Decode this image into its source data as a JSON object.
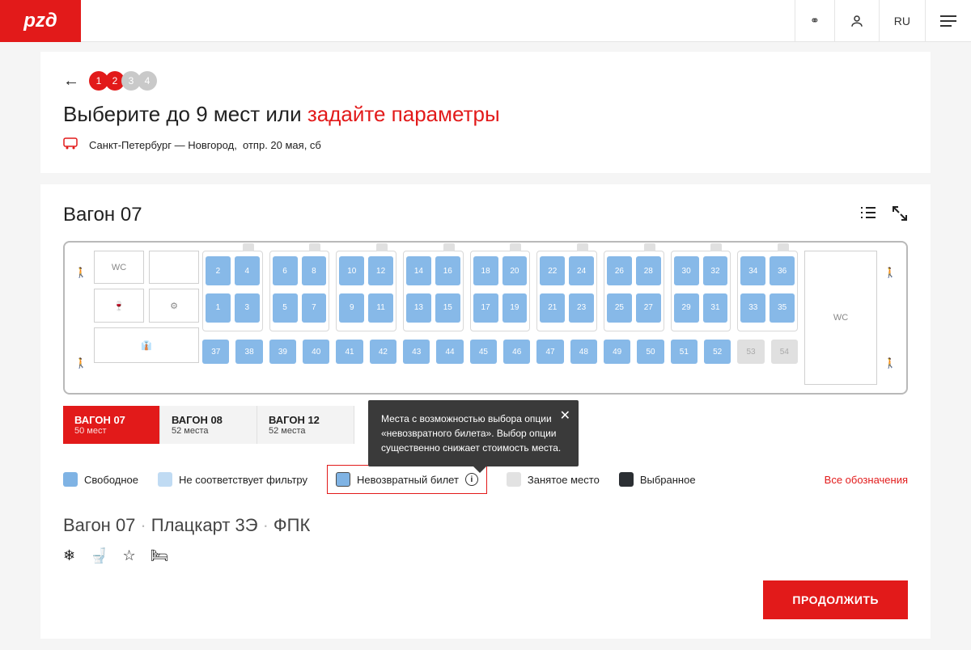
{
  "header": {
    "logo": "pzд",
    "lang": "RU"
  },
  "steps": {
    "labels": [
      "1",
      "2",
      "3",
      "4"
    ],
    "active": 2
  },
  "title": {
    "part1": "Выберите до 9 мест  или ",
    "part2": "задайте параметры"
  },
  "route": {
    "from": "Санкт-Петербург",
    "to": "Новгород",
    "dep": "отпр. 20 мая, сб"
  },
  "car": {
    "title": "Вагон 07",
    "main_seats": {
      "upper": [
        "2",
        "4",
        "6",
        "8",
        "10",
        "12",
        "14",
        "16",
        "18",
        "20",
        "22",
        "24",
        "26",
        "28",
        "30",
        "32",
        "34",
        "36"
      ],
      "lower": [
        "1",
        "3",
        "5",
        "7",
        "9",
        "11",
        "13",
        "15",
        "17",
        "19",
        "21",
        "23",
        "25",
        "27",
        "29",
        "31",
        "33",
        "35"
      ]
    },
    "side_seats": [
      "54",
      "53",
      "52",
      "51",
      "50",
      "49",
      "48",
      "47",
      "46",
      "45",
      "44",
      "43",
      "42",
      "41",
      "40",
      "39",
      "38",
      "37"
    ],
    "side_disabled": [
      "54",
      "53"
    ],
    "wc": "WC"
  },
  "tabs": [
    {
      "name": "ВАГОН 07",
      "count": "50 мест",
      "active": true
    },
    {
      "name": "ВАГОН 08",
      "count": "52 места",
      "active": false
    },
    {
      "name": "ВАГОН 12",
      "count": "52 места",
      "active": false
    }
  ],
  "legend": {
    "free": "Свободное",
    "filter": "Не соответствует фильтру",
    "nonref": "Невозвратный билет",
    "occupied": "Занятое место",
    "selected": "Выбранное",
    "all": "Все обозначения"
  },
  "tooltip": "Места с возможностью выбора опции «невозвратного билета». Выбор опции существенно снижает стоимость места.",
  "detail": {
    "car": "Вагон 07",
    "type": "Плацкарт 3Э",
    "carrier": "ФПК"
  },
  "continue": "ПРОДОЛЖИТЬ"
}
